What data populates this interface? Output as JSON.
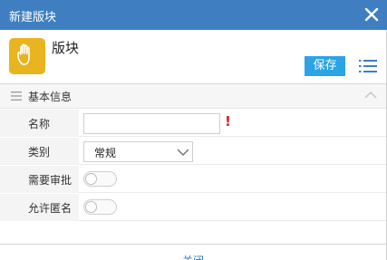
{
  "dialog": {
    "title": "新建版块",
    "close_icon": "close-icon"
  },
  "header": {
    "icon": "hand-icon",
    "icon_color": "#e8b420",
    "title": "版块",
    "save_label": "保存",
    "menu_icon": "list-menu-icon"
  },
  "section": {
    "title": "基本信息",
    "collapse_icon": "chevron-up-icon"
  },
  "form": {
    "name_label": "名称",
    "name_value": "",
    "name_required": "!",
    "category_label": "类别",
    "category_value": "常规",
    "approval_label": "需要审批",
    "approval_on": false,
    "anonymous_label": "允许匿名",
    "anonymous_on": false
  },
  "footer": {
    "close_label": "关闭"
  },
  "colors": {
    "titlebar": "#3f7fc1",
    "save_button": "#2aa4e4",
    "required": "#e02020"
  }
}
